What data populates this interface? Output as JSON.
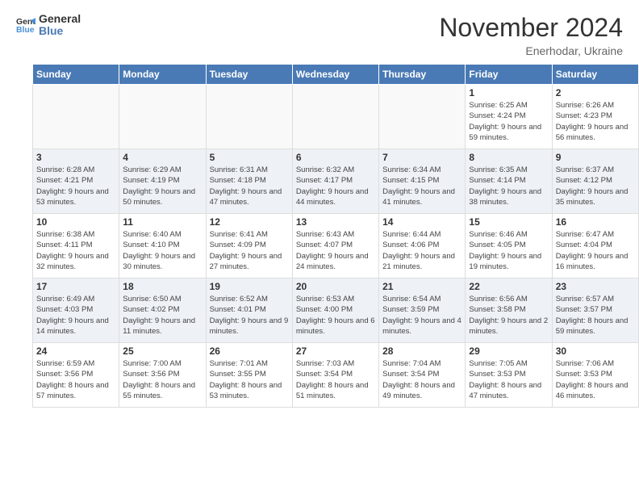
{
  "header": {
    "logo_line1": "General",
    "logo_line2": "Blue",
    "month_year": "November 2024",
    "location": "Enerhodar, Ukraine"
  },
  "days_of_week": [
    "Sunday",
    "Monday",
    "Tuesday",
    "Wednesday",
    "Thursday",
    "Friday",
    "Saturday"
  ],
  "weeks": [
    [
      {
        "day": "",
        "info": ""
      },
      {
        "day": "",
        "info": ""
      },
      {
        "day": "",
        "info": ""
      },
      {
        "day": "",
        "info": ""
      },
      {
        "day": "",
        "info": ""
      },
      {
        "day": "1",
        "info": "Sunrise: 6:25 AM\nSunset: 4:24 PM\nDaylight: 9 hours and 59 minutes."
      },
      {
        "day": "2",
        "info": "Sunrise: 6:26 AM\nSunset: 4:23 PM\nDaylight: 9 hours and 56 minutes."
      }
    ],
    [
      {
        "day": "3",
        "info": "Sunrise: 6:28 AM\nSunset: 4:21 PM\nDaylight: 9 hours and 53 minutes."
      },
      {
        "day": "4",
        "info": "Sunrise: 6:29 AM\nSunset: 4:19 PM\nDaylight: 9 hours and 50 minutes."
      },
      {
        "day": "5",
        "info": "Sunrise: 6:31 AM\nSunset: 4:18 PM\nDaylight: 9 hours and 47 minutes."
      },
      {
        "day": "6",
        "info": "Sunrise: 6:32 AM\nSunset: 4:17 PM\nDaylight: 9 hours and 44 minutes."
      },
      {
        "day": "7",
        "info": "Sunrise: 6:34 AM\nSunset: 4:15 PM\nDaylight: 9 hours and 41 minutes."
      },
      {
        "day": "8",
        "info": "Sunrise: 6:35 AM\nSunset: 4:14 PM\nDaylight: 9 hours and 38 minutes."
      },
      {
        "day": "9",
        "info": "Sunrise: 6:37 AM\nSunset: 4:12 PM\nDaylight: 9 hours and 35 minutes."
      }
    ],
    [
      {
        "day": "10",
        "info": "Sunrise: 6:38 AM\nSunset: 4:11 PM\nDaylight: 9 hours and 32 minutes."
      },
      {
        "day": "11",
        "info": "Sunrise: 6:40 AM\nSunset: 4:10 PM\nDaylight: 9 hours and 30 minutes."
      },
      {
        "day": "12",
        "info": "Sunrise: 6:41 AM\nSunset: 4:09 PM\nDaylight: 9 hours and 27 minutes."
      },
      {
        "day": "13",
        "info": "Sunrise: 6:43 AM\nSunset: 4:07 PM\nDaylight: 9 hours and 24 minutes."
      },
      {
        "day": "14",
        "info": "Sunrise: 6:44 AM\nSunset: 4:06 PM\nDaylight: 9 hours and 21 minutes."
      },
      {
        "day": "15",
        "info": "Sunrise: 6:46 AM\nSunset: 4:05 PM\nDaylight: 9 hours and 19 minutes."
      },
      {
        "day": "16",
        "info": "Sunrise: 6:47 AM\nSunset: 4:04 PM\nDaylight: 9 hours and 16 minutes."
      }
    ],
    [
      {
        "day": "17",
        "info": "Sunrise: 6:49 AM\nSunset: 4:03 PM\nDaylight: 9 hours and 14 minutes."
      },
      {
        "day": "18",
        "info": "Sunrise: 6:50 AM\nSunset: 4:02 PM\nDaylight: 9 hours and 11 minutes."
      },
      {
        "day": "19",
        "info": "Sunrise: 6:52 AM\nSunset: 4:01 PM\nDaylight: 9 hours and 9 minutes."
      },
      {
        "day": "20",
        "info": "Sunrise: 6:53 AM\nSunset: 4:00 PM\nDaylight: 9 hours and 6 minutes."
      },
      {
        "day": "21",
        "info": "Sunrise: 6:54 AM\nSunset: 3:59 PM\nDaylight: 9 hours and 4 minutes."
      },
      {
        "day": "22",
        "info": "Sunrise: 6:56 AM\nSunset: 3:58 PM\nDaylight: 9 hours and 2 minutes."
      },
      {
        "day": "23",
        "info": "Sunrise: 6:57 AM\nSunset: 3:57 PM\nDaylight: 8 hours and 59 minutes."
      }
    ],
    [
      {
        "day": "24",
        "info": "Sunrise: 6:59 AM\nSunset: 3:56 PM\nDaylight: 8 hours and 57 minutes."
      },
      {
        "day": "25",
        "info": "Sunrise: 7:00 AM\nSunset: 3:56 PM\nDaylight: 8 hours and 55 minutes."
      },
      {
        "day": "26",
        "info": "Sunrise: 7:01 AM\nSunset: 3:55 PM\nDaylight: 8 hours and 53 minutes."
      },
      {
        "day": "27",
        "info": "Sunrise: 7:03 AM\nSunset: 3:54 PM\nDaylight: 8 hours and 51 minutes."
      },
      {
        "day": "28",
        "info": "Sunrise: 7:04 AM\nSunset: 3:54 PM\nDaylight: 8 hours and 49 minutes."
      },
      {
        "day": "29",
        "info": "Sunrise: 7:05 AM\nSunset: 3:53 PM\nDaylight: 8 hours and 47 minutes."
      },
      {
        "day": "30",
        "info": "Sunrise: 7:06 AM\nSunset: 3:53 PM\nDaylight: 8 hours and 46 minutes."
      }
    ]
  ]
}
